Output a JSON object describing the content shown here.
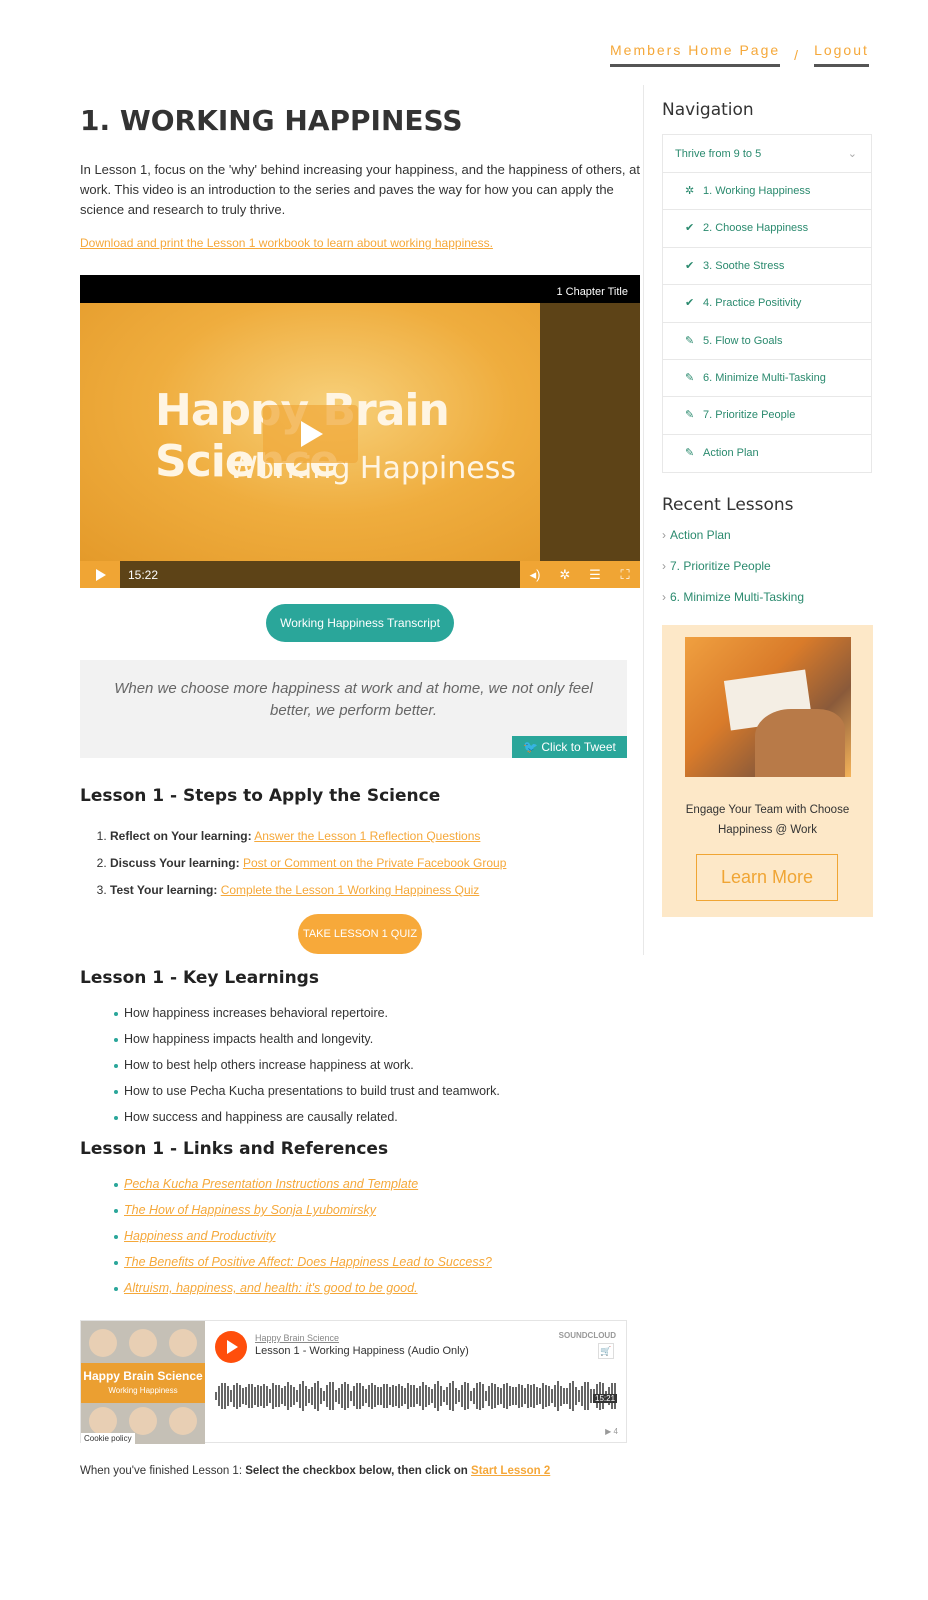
{
  "topnav": {
    "members_home": "Members Home Page",
    "separator": "/",
    "logout": "Logout"
  },
  "main": {
    "title": "1. WORKING HAPPINESS",
    "intro": "In Lesson 1, focus on the 'why' behind increasing your happiness, and the happiness of others, at work. This video is an introduction to the series and paves the way for how you can apply the science and research to truly thrive.",
    "download_link": "Download and print the Lesson 1 workbook to learn about working happiness.",
    "video": {
      "chapter_title": "1 Chapter Title",
      "title_line1": "Happy Brain Science",
      "title_line2": "Working Happiness",
      "time": "15:22",
      "icons": [
        "volume-icon",
        "gear-icon",
        "chapters-icon",
        "fullscreen-icon"
      ]
    },
    "transcript_button": "Working Happiness Transcript",
    "quote": "When we choose more happiness at work and at home, we not only feel better, we perform better.",
    "tweet_button": "Click to Tweet",
    "steps": {
      "heading": "Lesson 1 - Steps to Apply the Science",
      "items": [
        {
          "label": "Reflect on Your learning:",
          "link": "Answer the Lesson 1 Reflection Questions"
        },
        {
          "label": "Discuss Your learning:",
          "link": "Post or Comment on the Private Facebook Group"
        },
        {
          "label": "Test Your learning:",
          "link": "Complete the Lesson 1 Working Happiness Quiz"
        }
      ],
      "quiz_button": "TAKE LESSON 1 QUIZ"
    },
    "key_learnings": {
      "heading": "Lesson 1 - Key Learnings",
      "items": [
        "How happiness increases behavioral repertoire.",
        "How happiness impacts health and longevity.",
        "How to best help others increase happiness at work.",
        "How to use Pecha Kucha presentations to build trust and teamwork.",
        "How success and happiness are causally related."
      ]
    },
    "references": {
      "heading": "Lesson 1 - Links and References",
      "items": [
        "Pecha Kucha Presentation Instructions and Template",
        "The How of Happiness by Sonja Lyubomirsky",
        "Happiness and Productivity",
        "The Benefits of Positive Affect: Does Happiness Lead to Success?",
        "Altruism, happiness, and health: it's good to be good."
      ]
    },
    "soundcloud": {
      "art_title": "Happy Brain Science",
      "art_subtitle": "Working Happiness",
      "cookie": "Cookie policy",
      "user": "Happy Brain Science",
      "track": "Lesson 1 - Working Happiness (Audio Only)",
      "brand": "SOUNDCLOUD",
      "duration": "15:21",
      "plays": "▶ 4"
    },
    "finish": {
      "prefix": "When you've finished Lesson 1: ",
      "bold": "Select the checkbox below, then click on ",
      "link": "Start Lesson 2"
    }
  },
  "sidebar": {
    "nav_heading": "Navigation",
    "course": "Thrive from 9 to 5",
    "lessons": [
      {
        "label": "1. Working Happiness",
        "icon": "gear-icon"
      },
      {
        "label": "2. Choose Happiness",
        "icon": "check-icon"
      },
      {
        "label": "3. Soothe Stress",
        "icon": "check-icon"
      },
      {
        "label": "4. Practice Positivity",
        "icon": "check-icon"
      },
      {
        "label": "5. Flow to Goals",
        "icon": "pencil-icon"
      },
      {
        "label": "6. Minimize Multi-Tasking",
        "icon": "pencil-icon"
      },
      {
        "label": "7. Prioritize People",
        "icon": "pencil-icon"
      },
      {
        "label": "Action Plan",
        "icon": "pencil-icon"
      }
    ],
    "recent_heading": "Recent Lessons",
    "recent": [
      "Action Plan",
      "7. Prioritize People",
      "6. Minimize Multi-Tasking"
    ],
    "promo_text": "Engage Your Team with Choose Happiness @ Work",
    "learn_more": "Learn More"
  },
  "colors": {
    "accent_orange": "#f5a83a",
    "teal": "#2aa69a",
    "nav_green": "#2a8a6e"
  }
}
